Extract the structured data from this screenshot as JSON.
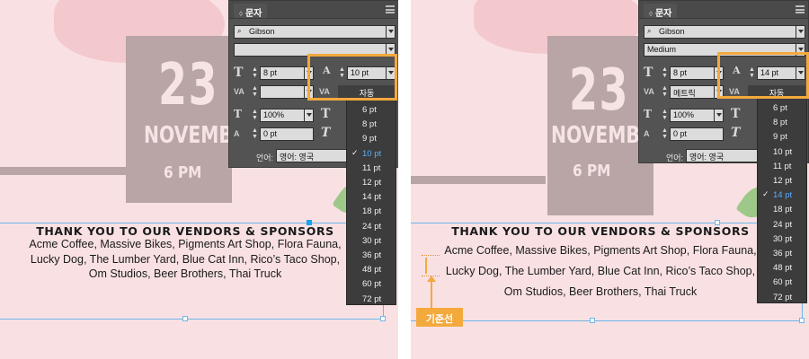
{
  "left": {
    "date": {
      "day": "23",
      "month": "NOVEMBER",
      "time": "6 PM"
    },
    "invite": {
      "heading": "THANK YOU TO OUR VENDORS & SPONSORS",
      "lines": [
        "Acme Coffee, Massive Bikes, Pigments Art Shop, Flora Fauna,",
        "Lucky Dog, The Lumber Yard, Blue Cat Inn, Rico’s Taco Shop,",
        "Om Studios, Beer Brothers, Thai Truck"
      ]
    },
    "panel": {
      "tab": "문자",
      "font_family": "Gibson",
      "font_style": "",
      "font_size": "8 pt",
      "leading": "10 pt",
      "kerning": "",
      "tracking_label": "자동",
      "vertical_scale": "100%",
      "baseline_shift": "0 pt",
      "language_label": "언어:",
      "language": "영어: 영국"
    },
    "leading_options": [
      "6 pt",
      "8 pt",
      "9 pt",
      "10 pt",
      "11 pt",
      "12 pt",
      "14 pt",
      "18 pt",
      "24 pt",
      "30 pt",
      "36 pt",
      "48 pt",
      "60 pt",
      "72 pt"
    ],
    "leading_selected": "10 pt"
  },
  "right": {
    "date": {
      "day": "23",
      "month": "NOVEMBER",
      "time": "6 PM"
    },
    "invite": {
      "heading": "THANK YOU TO OUR VENDORS & SPONSORS",
      "lines": [
        "Acme Coffee, Massive Bikes, Pigments Art Shop, Flora Fauna,",
        "Lucky Dog, The Lumber Yard, Blue Cat Inn, Rico’s Taco Shop,",
        "Om Studios, Beer Brothers, Thai Truck"
      ]
    },
    "panel": {
      "tab": "문자",
      "font_family": "Gibson",
      "font_style": "Medium",
      "font_size": "8 pt",
      "leading": "14 pt",
      "kerning": "메트릭",
      "tracking_label": "자동",
      "vertical_scale": "100%",
      "baseline_shift": "0 pt",
      "language_label": "언어:",
      "language": "영어: 영국"
    },
    "leading_options": [
      "6 pt",
      "8 pt",
      "9 pt",
      "10 pt",
      "11 pt",
      "12 pt",
      "14 pt",
      "18 pt",
      "24 pt",
      "30 pt",
      "36 pt",
      "48 pt",
      "60 pt",
      "72 pt"
    ],
    "leading_selected": "14 pt",
    "baseline_callout": "기준선"
  },
  "icons": {
    "search": "search-icon",
    "font_size": "font-size-icon",
    "leading": "leading-icon",
    "kerning": "kerning-icon",
    "tracking": "tracking-icon",
    "vertical_scale": "vertical-scale-icon",
    "horizontal_scale": "horizontal-scale-icon",
    "baseline_shift": "baseline-shift-icon",
    "skew": "skew-icon",
    "checkmark": "checkmark-icon"
  },
  "colors": {
    "highlight": "#f3a93c",
    "selection": "#5aaeff",
    "frame": "#6fb6e8",
    "background": "#f9e1e3"
  }
}
